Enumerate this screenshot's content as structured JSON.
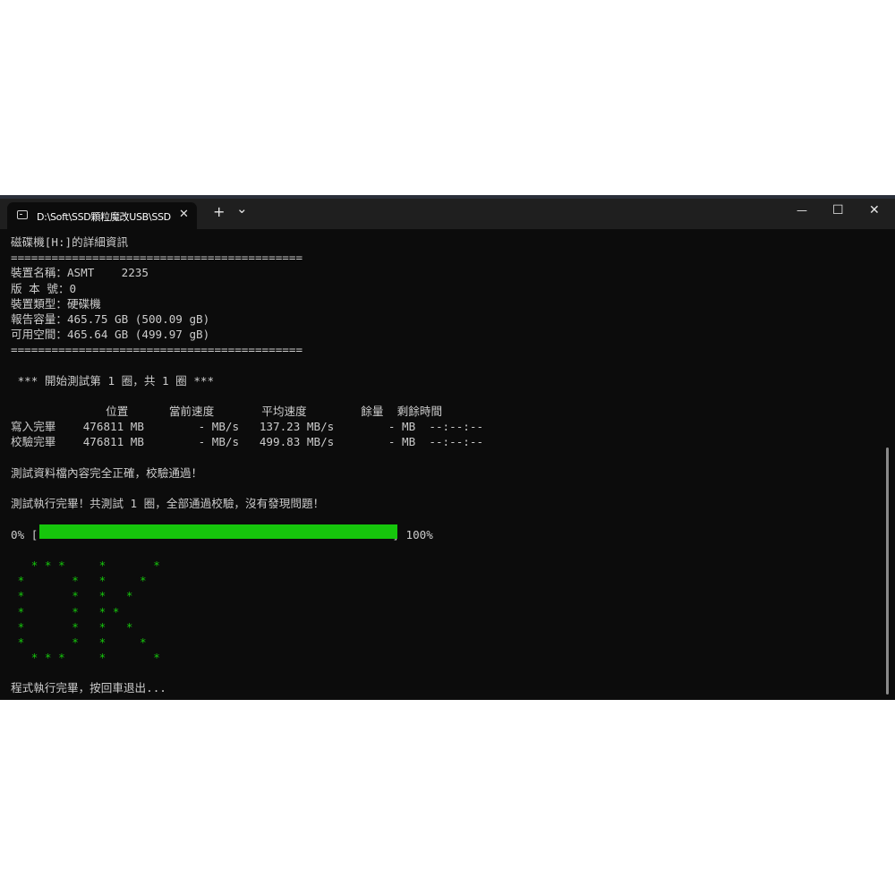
{
  "tab": {
    "title": "D:\\Soft\\SSD顆粒魔改USB\\SSD",
    "close": "✕",
    "new_tab": "+",
    "dropdown": "⌄"
  },
  "window_controls": {
    "minimize": "—",
    "maximize": "☐",
    "close": "✕"
  },
  "terminal": {
    "header": "磁碟機[H:]的詳細資訊",
    "separator": "===========================================",
    "device_name": "裝置名稱：ASMT    2235",
    "version": "版 本 號：0",
    "device_type": "裝置類型：硬碟機",
    "reported_capacity": "報告容量：465.75 GB (500.09 gB)",
    "free_space": "可用空間：465.64 GB (499.97 gB)",
    "separator2": "===========================================",
    "test_header": " *** 開始測試第 1 圈，共 1 圈 ***",
    "table_header": "              位置      當前速度       平均速度        餘量  剩餘時間",
    "write_row": "寫入完畢    476811 MB        - MB/s   137.23 MB/s        - MB  --:--:--",
    "verify_row": "校驗完畢    476811 MB        - MB/s   499.83 MB/s        - MB  --:--:--",
    "verify_ok": "測試資料檔內容完全正確，校驗通過！",
    "complete": "測試執行完畢！共測試 1 圈，全部通過校驗，沒有發現問題！",
    "progress_start": "0% [",
    "progress_end": "] 100%",
    "progress_value": 1.0,
    "ok_art": [
      "   * * *     *       *",
      " *       *   *     *",
      " *       *   *   *",
      " *       *   * *",
      " *       *   *   *",
      " *       *   *     *",
      "   * * *     *       *"
    ],
    "exit_prompt": "程式執行完畢，按回車退出..."
  },
  "colors": {
    "background": "#0c0c0c",
    "text": "#cccccc",
    "accent": "#16c60c",
    "titlebar": "#1f1f1f"
  }
}
